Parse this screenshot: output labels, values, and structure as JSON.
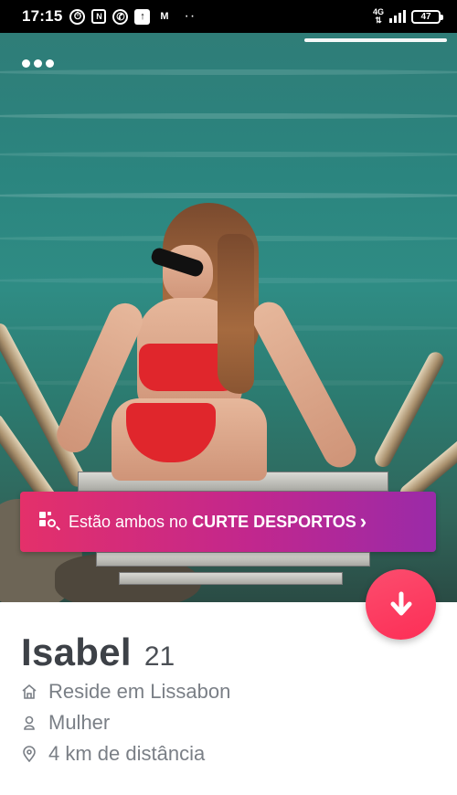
{
  "status_bar": {
    "time": "17:15",
    "network": "4G",
    "battery": "47",
    "more": "··"
  },
  "photo": {
    "description_icon": "more-options-icon"
  },
  "banner": {
    "prefix": "Estão ambos no ",
    "highlight": "CURTE DESPORTOS",
    "chevron": "›"
  },
  "profile": {
    "name": "Isabel",
    "age": "21",
    "residence": "Reside em Lissabon",
    "gender": "Mulher",
    "distance": "4 km de distância"
  },
  "colors": {
    "accent": "#fd2e56",
    "banner_start": "#e4306a",
    "banner_end": "#9a2aa8",
    "name_text": "#3d4147",
    "info_text": "#7a7f86"
  }
}
